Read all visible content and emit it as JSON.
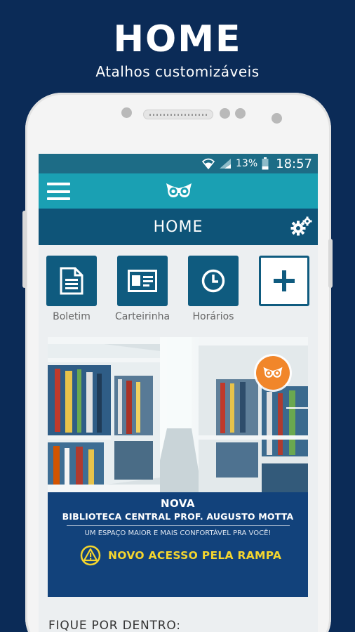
{
  "promo": {
    "title": "HOME",
    "subtitle": "Atalhos customizáveis"
  },
  "status_bar": {
    "battery": "13%",
    "time": "18:57"
  },
  "header": {
    "title": "HOME"
  },
  "shortcuts": [
    {
      "label": "Boletim",
      "icon": "document-icon"
    },
    {
      "label": "Carteirinha",
      "icon": "id-card-icon"
    },
    {
      "label": "Horários",
      "icon": "clock-icon"
    },
    {
      "label": "",
      "icon": "plus-icon"
    }
  ],
  "banner": {
    "headline": "NOVA",
    "library": "BIBLIOTECA CENTRAL PROF. AUGUSTO MOTTA",
    "tagline": "UM ESPAÇO MAIOR E MAIS CONFORTÁVEL PRA VOCÊ!",
    "notice": "NOVO ACESSO PELA RAMPA"
  },
  "section": {
    "title": "FIQUE POR DENTRO:"
  },
  "colors": {
    "background": "#0b2b57",
    "topbar": "#1aa0b3",
    "titlebar": "#0e5478",
    "tile": "#0f5b7f",
    "banner_panel": "#12427b",
    "notice_yellow": "#f4d52e",
    "badge_orange": "#f1862a"
  }
}
